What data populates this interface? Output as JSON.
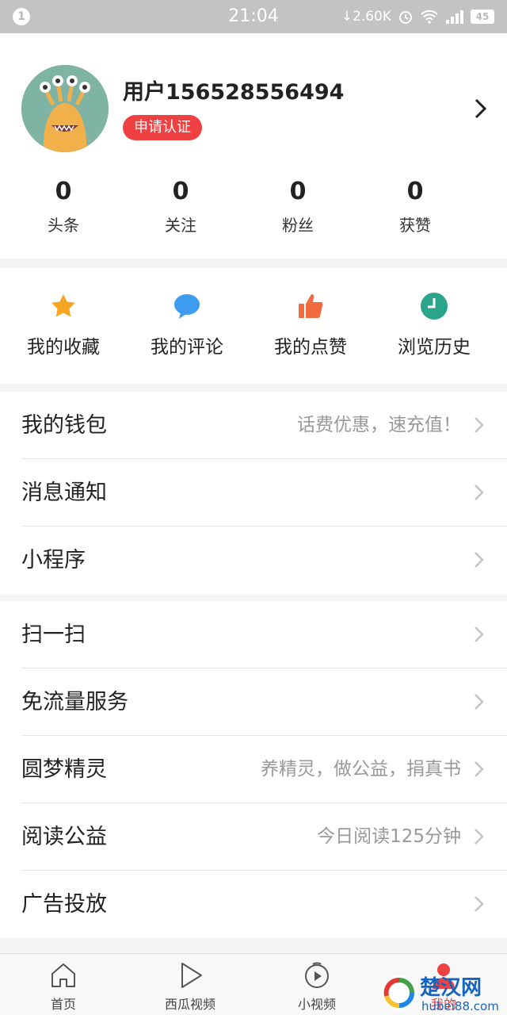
{
  "status_bar": {
    "notification_count": "1",
    "time": "21:04",
    "net_speed": "2.60K",
    "battery": "45"
  },
  "profile": {
    "username": "用户156528556494",
    "certify_label": "申请认证",
    "stats": [
      {
        "value": "0",
        "label": "头条"
      },
      {
        "value": "0",
        "label": "关注"
      },
      {
        "value": "0",
        "label": "粉丝"
      },
      {
        "value": "0",
        "label": "获赞"
      }
    ]
  },
  "actions": [
    {
      "label": "我的收藏",
      "icon": "star-icon",
      "color": "#f5a623"
    },
    {
      "label": "我的评论",
      "icon": "comment-icon",
      "color": "#3d9cf0"
    },
    {
      "label": "我的点赞",
      "icon": "thumbs-up-icon",
      "color": "#f06b3e"
    },
    {
      "label": "浏览历史",
      "icon": "clock-icon",
      "color": "#2aa48a"
    }
  ],
  "menu_group_1": [
    {
      "label": "我的钱包",
      "hint": "话费优惠，速充值！"
    },
    {
      "label": "消息通知",
      "hint": ""
    },
    {
      "label": "小程序",
      "hint": ""
    }
  ],
  "menu_group_2": [
    {
      "label": "扫一扫",
      "hint": ""
    },
    {
      "label": "免流量服务",
      "hint": ""
    },
    {
      "label": "圆梦精灵",
      "hint": "养精灵，做公益，捐真书"
    },
    {
      "label": "阅读公益",
      "hint": "今日阅读125分钟"
    },
    {
      "label": "广告投放",
      "hint": ""
    }
  ],
  "tabs": [
    {
      "label": "首页",
      "icon": "home-icon"
    },
    {
      "label": "西瓜视频",
      "icon": "play-icon"
    },
    {
      "label": "小视频",
      "icon": "short-video-icon"
    },
    {
      "label": "我的",
      "icon": "profile-icon"
    }
  ],
  "watermark": {
    "text": "楚汉网",
    "url": "hubei88.com"
  },
  "colors": {
    "accent": "#f04142",
    "divider": "#f4f5f6"
  }
}
